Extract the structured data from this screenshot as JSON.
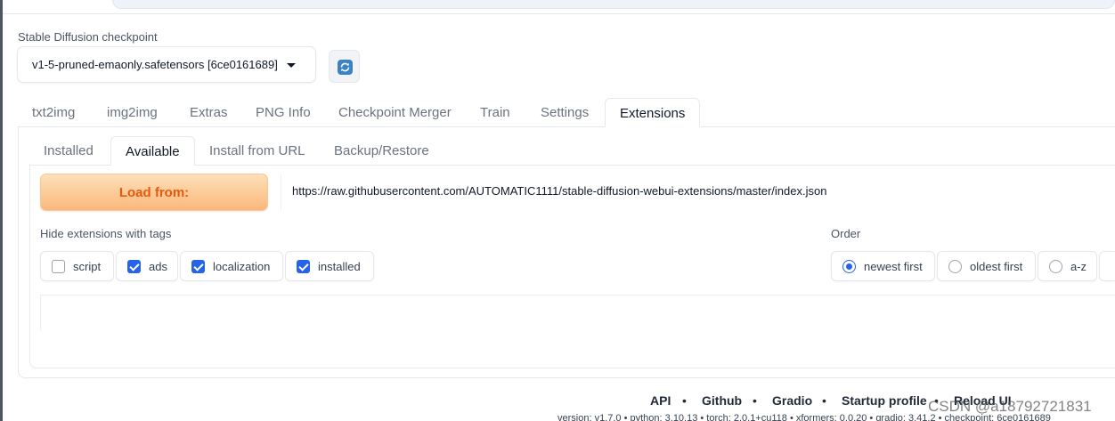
{
  "checkpoint": {
    "label": "Stable Diffusion checkpoint",
    "value": "v1-5-pruned-emaonly.safetensors [6ce0161689]"
  },
  "main_tabs": [
    {
      "label": "txt2img"
    },
    {
      "label": "img2img"
    },
    {
      "label": "Extras"
    },
    {
      "label": "PNG Info"
    },
    {
      "label": "Checkpoint Merger"
    },
    {
      "label": "Train"
    },
    {
      "label": "Settings"
    },
    {
      "label": "Extensions",
      "active": true
    }
  ],
  "sub_tabs": [
    {
      "label": "Installed"
    },
    {
      "label": "Available",
      "active": true
    },
    {
      "label": "Install from URL"
    },
    {
      "label": "Backup/Restore"
    }
  ],
  "load": {
    "button_label": "Load from:",
    "url": "https://raw.githubusercontent.com/AUTOMATIC1111/stable-diffusion-webui-extensions/master/index.json"
  },
  "hide_tags": {
    "label": "Hide extensions with tags",
    "options": [
      {
        "label": "script",
        "checked": false
      },
      {
        "label": "ads",
        "checked": true
      },
      {
        "label": "localization",
        "checked": true
      },
      {
        "label": "installed",
        "checked": true
      }
    ]
  },
  "order": {
    "label": "Order",
    "options": [
      {
        "label": "newest first",
        "selected": true
      },
      {
        "label": "oldest first",
        "selected": false
      },
      {
        "label": "a-z",
        "selected": false
      }
    ]
  },
  "footer": {
    "links": [
      "API",
      "Github",
      "Gradio",
      "Startup profile",
      "Reload UI"
    ],
    "separator": "•",
    "version_line": "version: v1.7.0  •  python: 3.10.13  •  torch: 2.0.1+cu118  •  xformers: 0.0.20  •  gradio: 3.41.2  •  checkpoint: 6ce0161689"
  },
  "watermark": "CSDN @a18792721831",
  "colors": {
    "accent_blue": "#2563eb",
    "load_button_text": "#ea580c",
    "load_button_bg": "#fbb77b"
  }
}
